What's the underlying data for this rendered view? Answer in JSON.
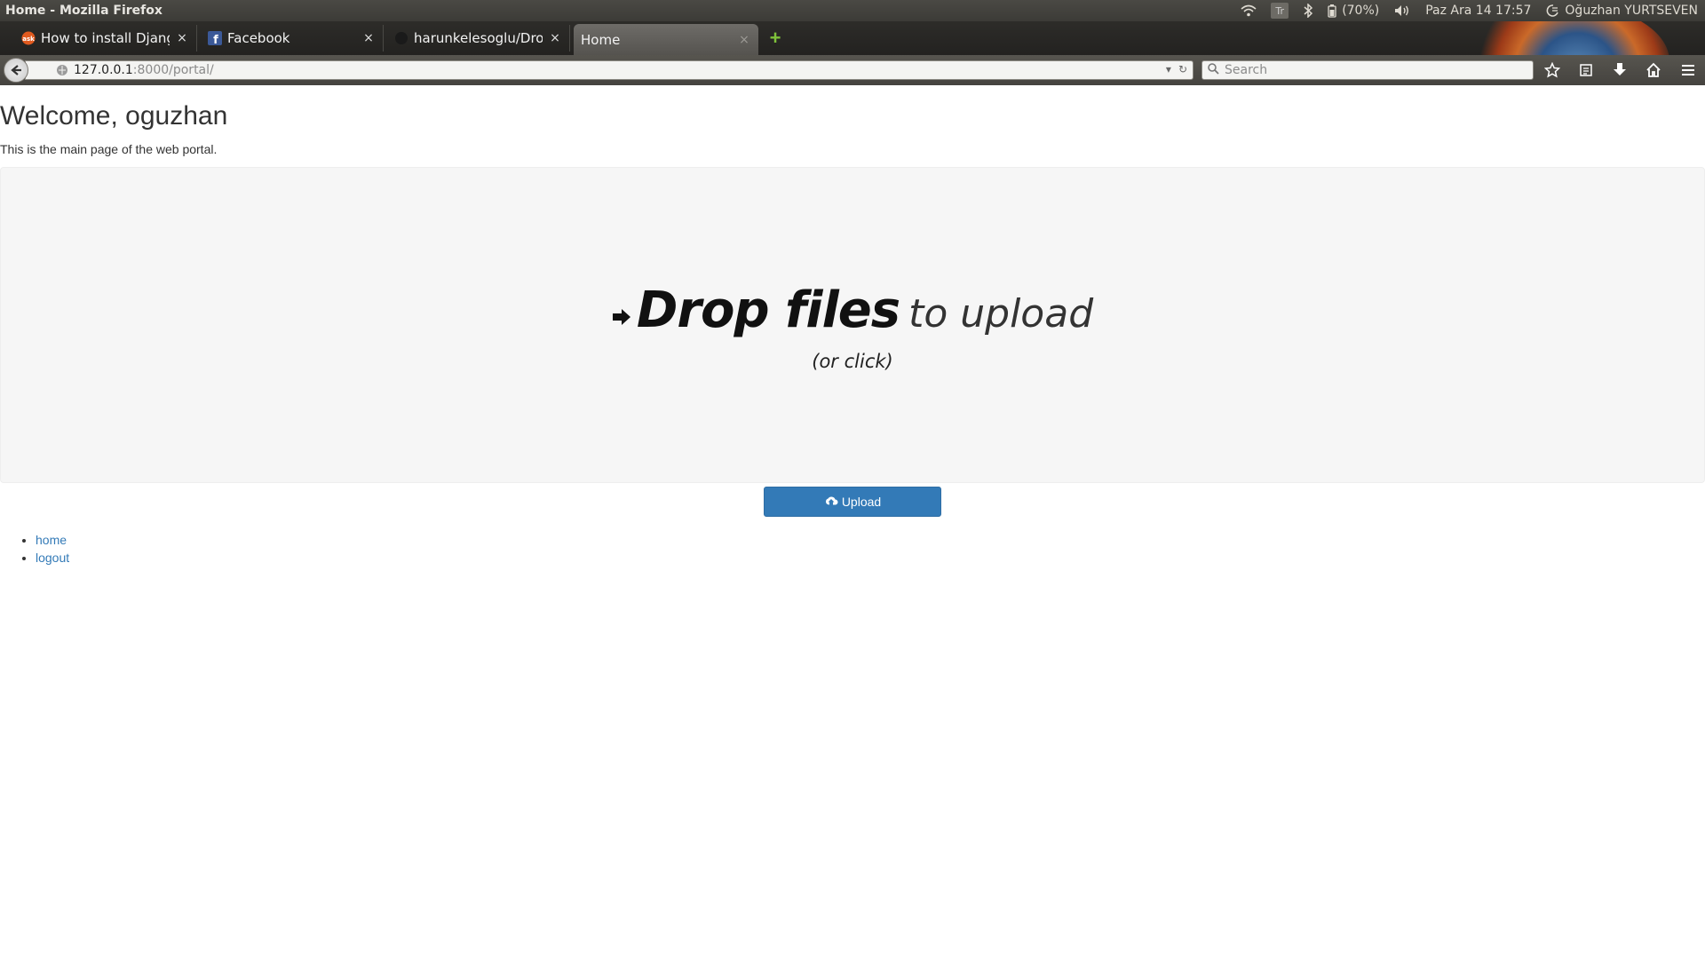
{
  "os_panel": {
    "window_title": "Home - Mozilla Firefox",
    "battery": "(70%)",
    "datetime": "Paz Ara 14 17:57",
    "user": "Oğuzhan YURTSEVEN",
    "keyboard": "Tr"
  },
  "tabs": [
    {
      "label": "How to install Djang...",
      "favicon": "askubuntu-icon"
    },
    {
      "label": "Facebook",
      "favicon": "facebook-icon"
    },
    {
      "label": "harunkelesoglu/Dro...",
      "favicon": "github-icon"
    },
    {
      "label": "Home",
      "favicon": "none",
      "active": true
    }
  ],
  "tab_close_glyph": "×",
  "new_tab_glyph": "+",
  "navbar": {
    "url_host": "127.0.0.1",
    "url_path": ":8000/portal/",
    "search_placeholder": "Search"
  },
  "page": {
    "heading": "Welcome, oguzhan",
    "intro": "This is the main page of the web portal.",
    "dropzone": {
      "bold_text": "Drop files",
      "light_text": "to upload",
      "sub_text": "(or click)"
    },
    "upload_label": "Upload",
    "links": [
      {
        "label": "home"
      },
      {
        "label": "logout"
      }
    ]
  },
  "colors": {
    "primary_button": "#337ab7",
    "link": "#337ab7",
    "dropzone_bg": "#f6f6f6"
  }
}
